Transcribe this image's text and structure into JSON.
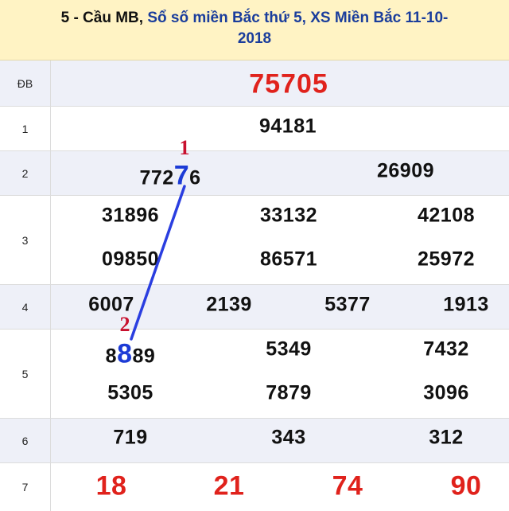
{
  "header": {
    "prefix": "5 - Cầu MB,",
    "link_line1": "Sổ số miền Bắc thứ 5, XS Miền Bắc 11-10-",
    "link_line2": "2018"
  },
  "rows": [
    {
      "label": "ĐB"
    },
    {
      "label": "1"
    },
    {
      "label": "2"
    },
    {
      "label": "3"
    },
    {
      "label": "4"
    },
    {
      "label": "5"
    },
    {
      "label": "6"
    },
    {
      "label": "7"
    }
  ],
  "prizes": {
    "db": "75705",
    "g1": "94181",
    "g2": {
      "a_pre": "772",
      "a_hl": "7",
      "a_post": "6",
      "b": "26909"
    },
    "g3": [
      "31896",
      "33132",
      "42108",
      "09850",
      "86571",
      "25972"
    ],
    "g4": [
      "6007",
      "2139",
      "5377",
      "1913"
    ],
    "g5": {
      "a_pre": "8",
      "a_hl": "8",
      "a_post": "89",
      "b": "5349",
      "c": "7432",
      "d": "5305",
      "e": "7879",
      "f": "3096"
    },
    "g6": [
      "719",
      "343",
      "312"
    ],
    "g7": [
      "18",
      "21",
      "74",
      "90"
    ]
  },
  "markers": {
    "start": "1",
    "end": "2"
  },
  "colors": {
    "header_bg": "#fff3c4",
    "link": "#1a3d9c",
    "red": "#e0221c",
    "highlight": "#1c3bd6",
    "marker": "#c8102e"
  }
}
